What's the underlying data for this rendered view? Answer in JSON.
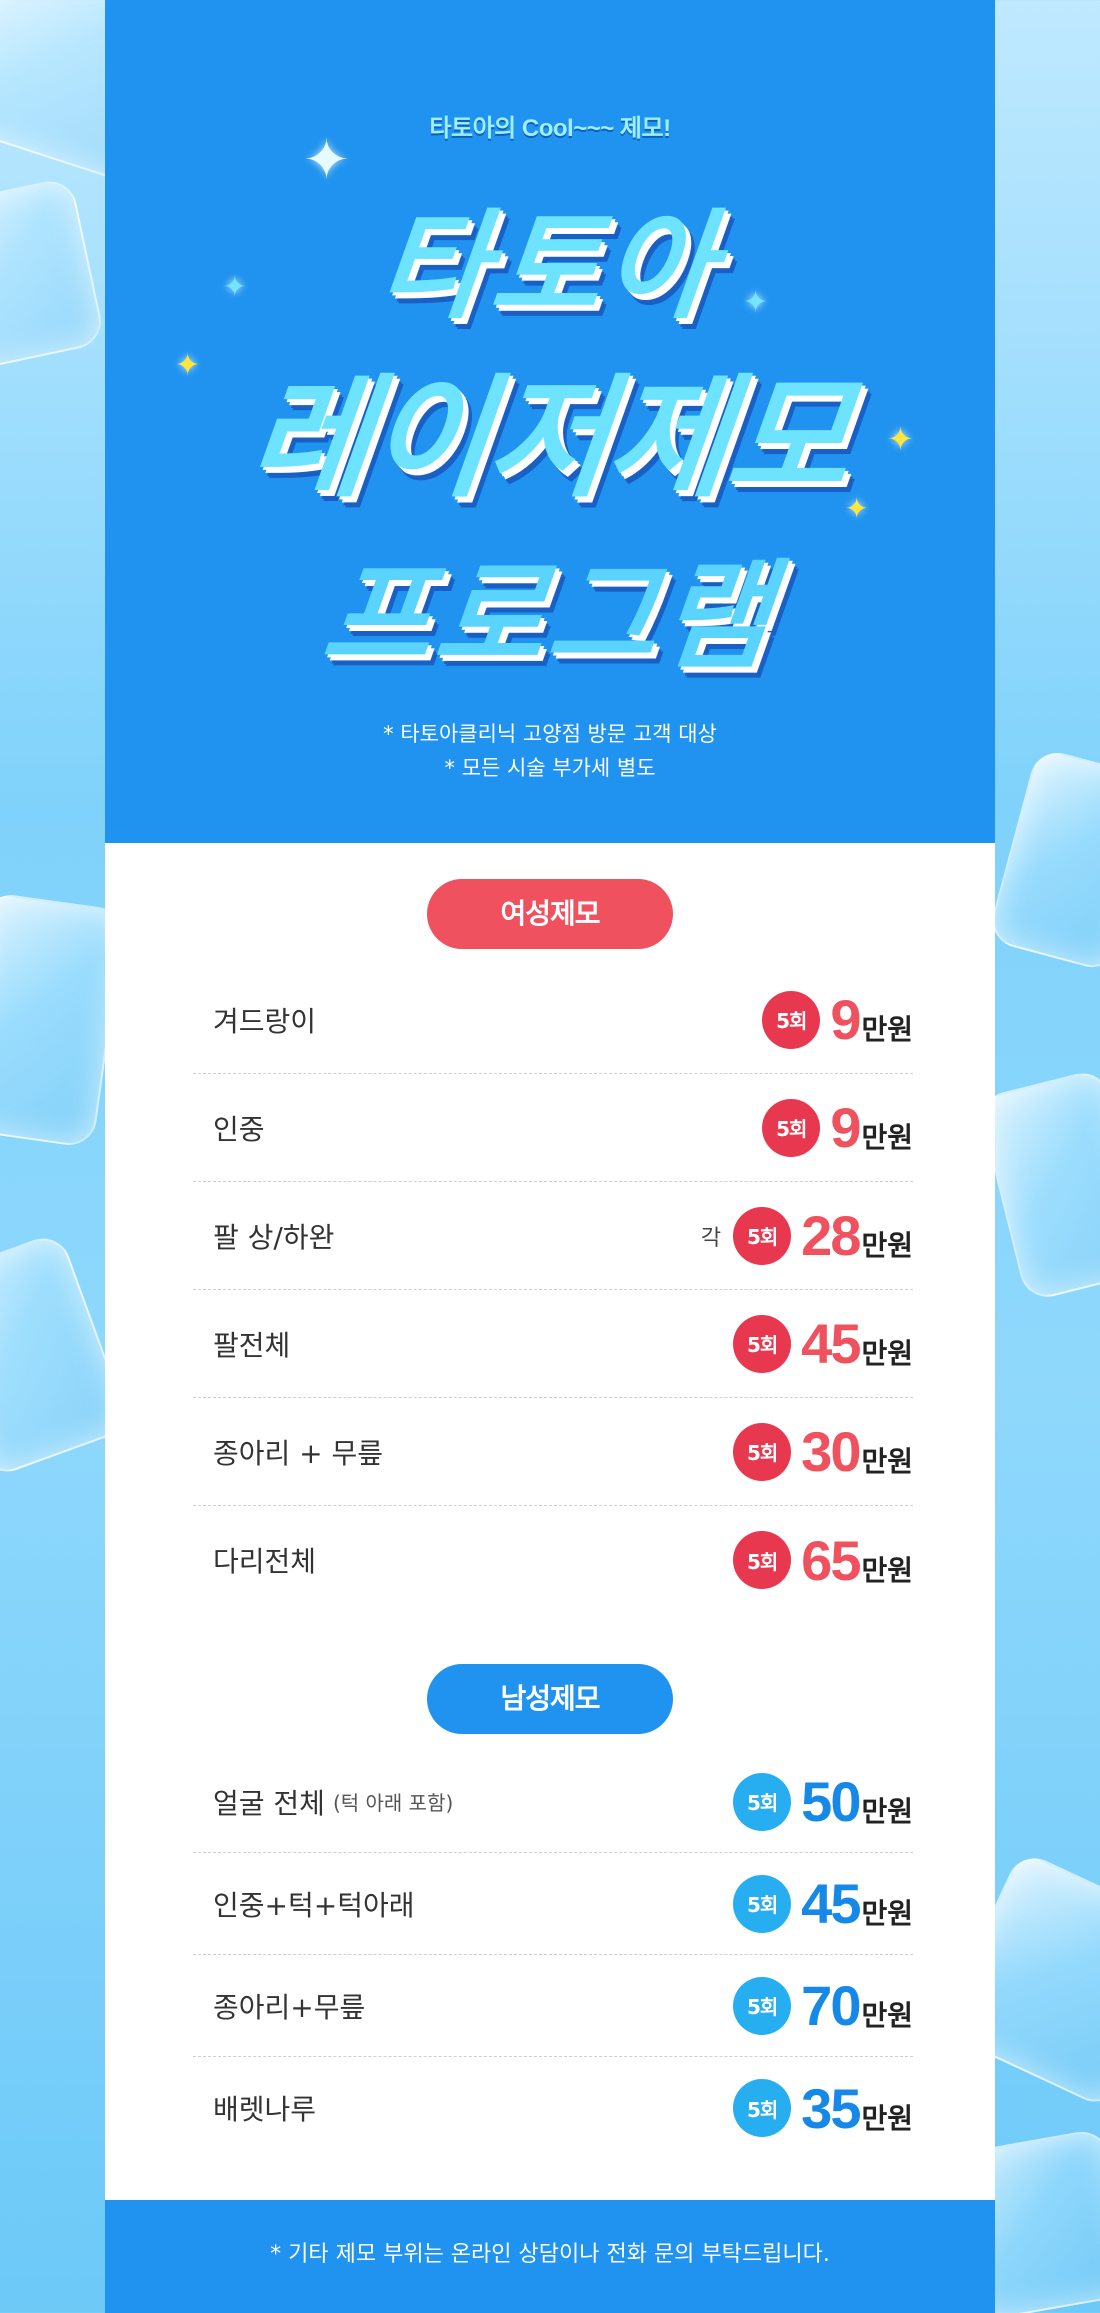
{
  "hero": {
    "tagline": "타토아의 Cool~~~ 제모!",
    "title_line1": "타토아",
    "title_line2": "레이저제모",
    "title_line3": "프로그램",
    "note1": "* 타토아클리닉 고양점 방문 고객 대상",
    "note2": "* 모든 시술 부가세 별도",
    "sparkle_color_yellow": "#ffe63b",
    "sparkle_color_cyan": "#72e6ff"
  },
  "women": {
    "label": "여성제모",
    "accent": "#f0515f",
    "items": [
      {
        "name": "겨드랑이",
        "sub": "",
        "each": "",
        "sessions": "5회",
        "price": "9",
        "unit": "만원"
      },
      {
        "name": "인중",
        "sub": "",
        "each": "",
        "sessions": "5회",
        "price": "9",
        "unit": "만원"
      },
      {
        "name": "팔 상/하완",
        "sub": "",
        "each": "각",
        "sessions": "5회",
        "price": "28",
        "unit": "만원"
      },
      {
        "name": "팔전체",
        "sub": "",
        "each": "",
        "sessions": "5회",
        "price": "45",
        "unit": "만원"
      },
      {
        "name": "종아리 + 무릎",
        "sub": "",
        "each": "",
        "sessions": "5회",
        "price": "30",
        "unit": "만원"
      },
      {
        "name": "다리전체",
        "sub": "",
        "each": "",
        "sessions": "5회",
        "price": "65",
        "unit": "만원"
      }
    ]
  },
  "men": {
    "label": "남성제모",
    "accent": "#1f93ef",
    "items": [
      {
        "name": "얼굴 전체",
        "sub": "(턱 아래 포함)",
        "sessions": "5회",
        "price": "50",
        "unit": "만원"
      },
      {
        "name": "인중+턱+턱아래",
        "sub": "",
        "sessions": "5회",
        "price": "45",
        "unit": "만원"
      },
      {
        "name": "종아리+무릎",
        "sub": "",
        "sessions": "5회",
        "price": "70",
        "unit": "만원"
      },
      {
        "name": "배렛나루",
        "sub": "",
        "sessions": "5회",
        "price": "35",
        "unit": "만원"
      }
    ]
  },
  "footer": {
    "note": "* 기타 제모 부위는 온라인 상담이나 전화 문의 부탁드립니다."
  }
}
